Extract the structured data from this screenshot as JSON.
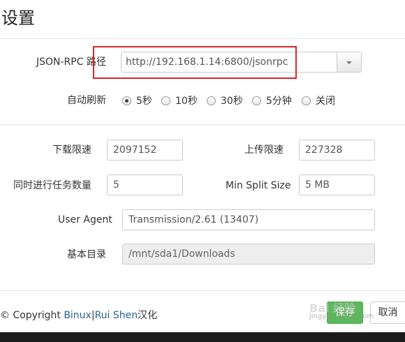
{
  "header": {
    "title": "设置"
  },
  "rpc": {
    "label": "JSON-RPC 路径",
    "value": "http://192.168.1.14:6800/jsonrpc"
  },
  "refresh": {
    "label": "自动刷新",
    "options": [
      {
        "label": "5秒",
        "checked": true
      },
      {
        "label": "10秒",
        "checked": false
      },
      {
        "label": "30秒",
        "checked": false
      },
      {
        "label": "5分钟",
        "checked": false
      },
      {
        "label": "关闭",
        "checked": false
      }
    ]
  },
  "form": {
    "download_limit_label": "下载限速",
    "download_limit_value": "2097152",
    "upload_limit_label": "上传限速",
    "upload_limit_value": "227328",
    "concurrent_label": "同时进行任务数量",
    "concurrent_value": "5",
    "min_split_label": "Min Split Size",
    "min_split_value": "5 MB",
    "user_agent_label": "User Agent",
    "user_agent_value": "Transmission/2.61 (13407)",
    "base_dir_label": "基本目录",
    "base_dir_value": "/mnt/sda1/Downloads"
  },
  "footer": {
    "copyright_prefix": "© Copyright ",
    "author1": "Binux",
    "separator": "|",
    "author2": "Rui Shen",
    "suffix": "汉化",
    "save_label": "保存",
    "cancel_label": "取消"
  },
  "watermark": {
    "top": "Bai 经验",
    "bottom": "jingyan.baidu.com"
  },
  "colors": {
    "highlight": "#d9252a",
    "save_button": "#5cb85c",
    "link": "#2a6496"
  }
}
